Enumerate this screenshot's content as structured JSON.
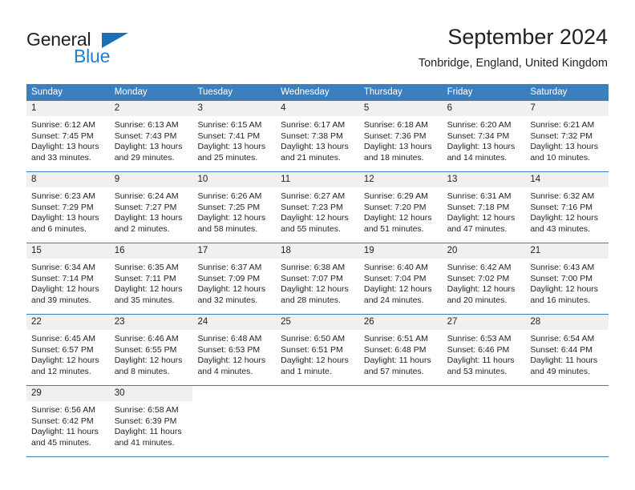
{
  "brand": {
    "name_part1": "General",
    "name_part2": "Blue",
    "accent_color": "#1f7fd4",
    "triangle_color": "#1f6fb5"
  },
  "header": {
    "title": "September 2024",
    "subtitle": "Tonbridge, England, United Kingdom"
  },
  "calendar": {
    "header_color": "#3b7fbf",
    "weekdays": [
      "Sunday",
      "Monday",
      "Tuesday",
      "Wednesday",
      "Thursday",
      "Friday",
      "Saturday"
    ],
    "weeks": [
      [
        {
          "day": "1",
          "sunrise": "Sunrise: 6:12 AM",
          "sunset": "Sunset: 7:45 PM",
          "daylight1": "Daylight: 13 hours",
          "daylight2": "and 33 minutes."
        },
        {
          "day": "2",
          "sunrise": "Sunrise: 6:13 AM",
          "sunset": "Sunset: 7:43 PM",
          "daylight1": "Daylight: 13 hours",
          "daylight2": "and 29 minutes."
        },
        {
          "day": "3",
          "sunrise": "Sunrise: 6:15 AM",
          "sunset": "Sunset: 7:41 PM",
          "daylight1": "Daylight: 13 hours",
          "daylight2": "and 25 minutes."
        },
        {
          "day": "4",
          "sunrise": "Sunrise: 6:17 AM",
          "sunset": "Sunset: 7:38 PM",
          "daylight1": "Daylight: 13 hours",
          "daylight2": "and 21 minutes."
        },
        {
          "day": "5",
          "sunrise": "Sunrise: 6:18 AM",
          "sunset": "Sunset: 7:36 PM",
          "daylight1": "Daylight: 13 hours",
          "daylight2": "and 18 minutes."
        },
        {
          "day": "6",
          "sunrise": "Sunrise: 6:20 AM",
          "sunset": "Sunset: 7:34 PM",
          "daylight1": "Daylight: 13 hours",
          "daylight2": "and 14 minutes."
        },
        {
          "day": "7",
          "sunrise": "Sunrise: 6:21 AM",
          "sunset": "Sunset: 7:32 PM",
          "daylight1": "Daylight: 13 hours",
          "daylight2": "and 10 minutes."
        }
      ],
      [
        {
          "day": "8",
          "sunrise": "Sunrise: 6:23 AM",
          "sunset": "Sunset: 7:29 PM",
          "daylight1": "Daylight: 13 hours",
          "daylight2": "and 6 minutes."
        },
        {
          "day": "9",
          "sunrise": "Sunrise: 6:24 AM",
          "sunset": "Sunset: 7:27 PM",
          "daylight1": "Daylight: 13 hours",
          "daylight2": "and 2 minutes."
        },
        {
          "day": "10",
          "sunrise": "Sunrise: 6:26 AM",
          "sunset": "Sunset: 7:25 PM",
          "daylight1": "Daylight: 12 hours",
          "daylight2": "and 58 minutes."
        },
        {
          "day": "11",
          "sunrise": "Sunrise: 6:27 AM",
          "sunset": "Sunset: 7:23 PM",
          "daylight1": "Daylight: 12 hours",
          "daylight2": "and 55 minutes."
        },
        {
          "day": "12",
          "sunrise": "Sunrise: 6:29 AM",
          "sunset": "Sunset: 7:20 PM",
          "daylight1": "Daylight: 12 hours",
          "daylight2": "and 51 minutes."
        },
        {
          "day": "13",
          "sunrise": "Sunrise: 6:31 AM",
          "sunset": "Sunset: 7:18 PM",
          "daylight1": "Daylight: 12 hours",
          "daylight2": "and 47 minutes."
        },
        {
          "day": "14",
          "sunrise": "Sunrise: 6:32 AM",
          "sunset": "Sunset: 7:16 PM",
          "daylight1": "Daylight: 12 hours",
          "daylight2": "and 43 minutes."
        }
      ],
      [
        {
          "day": "15",
          "sunrise": "Sunrise: 6:34 AM",
          "sunset": "Sunset: 7:14 PM",
          "daylight1": "Daylight: 12 hours",
          "daylight2": "and 39 minutes."
        },
        {
          "day": "16",
          "sunrise": "Sunrise: 6:35 AM",
          "sunset": "Sunset: 7:11 PM",
          "daylight1": "Daylight: 12 hours",
          "daylight2": "and 35 minutes."
        },
        {
          "day": "17",
          "sunrise": "Sunrise: 6:37 AM",
          "sunset": "Sunset: 7:09 PM",
          "daylight1": "Daylight: 12 hours",
          "daylight2": "and 32 minutes."
        },
        {
          "day": "18",
          "sunrise": "Sunrise: 6:38 AM",
          "sunset": "Sunset: 7:07 PM",
          "daylight1": "Daylight: 12 hours",
          "daylight2": "and 28 minutes."
        },
        {
          "day": "19",
          "sunrise": "Sunrise: 6:40 AM",
          "sunset": "Sunset: 7:04 PM",
          "daylight1": "Daylight: 12 hours",
          "daylight2": "and 24 minutes."
        },
        {
          "day": "20",
          "sunrise": "Sunrise: 6:42 AM",
          "sunset": "Sunset: 7:02 PM",
          "daylight1": "Daylight: 12 hours",
          "daylight2": "and 20 minutes."
        },
        {
          "day": "21",
          "sunrise": "Sunrise: 6:43 AM",
          "sunset": "Sunset: 7:00 PM",
          "daylight1": "Daylight: 12 hours",
          "daylight2": "and 16 minutes."
        }
      ],
      [
        {
          "day": "22",
          "sunrise": "Sunrise: 6:45 AM",
          "sunset": "Sunset: 6:57 PM",
          "daylight1": "Daylight: 12 hours",
          "daylight2": "and 12 minutes."
        },
        {
          "day": "23",
          "sunrise": "Sunrise: 6:46 AM",
          "sunset": "Sunset: 6:55 PM",
          "daylight1": "Daylight: 12 hours",
          "daylight2": "and 8 minutes."
        },
        {
          "day": "24",
          "sunrise": "Sunrise: 6:48 AM",
          "sunset": "Sunset: 6:53 PM",
          "daylight1": "Daylight: 12 hours",
          "daylight2": "and 4 minutes."
        },
        {
          "day": "25",
          "sunrise": "Sunrise: 6:50 AM",
          "sunset": "Sunset: 6:51 PM",
          "daylight1": "Daylight: 12 hours",
          "daylight2": "and 1 minute."
        },
        {
          "day": "26",
          "sunrise": "Sunrise: 6:51 AM",
          "sunset": "Sunset: 6:48 PM",
          "daylight1": "Daylight: 11 hours",
          "daylight2": "and 57 minutes."
        },
        {
          "day": "27",
          "sunrise": "Sunrise: 6:53 AM",
          "sunset": "Sunset: 6:46 PM",
          "daylight1": "Daylight: 11 hours",
          "daylight2": "and 53 minutes."
        },
        {
          "day": "28",
          "sunrise": "Sunrise: 6:54 AM",
          "sunset": "Sunset: 6:44 PM",
          "daylight1": "Daylight: 11 hours",
          "daylight2": "and 49 minutes."
        }
      ],
      [
        {
          "day": "29",
          "sunrise": "Sunrise: 6:56 AM",
          "sunset": "Sunset: 6:42 PM",
          "daylight1": "Daylight: 11 hours",
          "daylight2": "and 45 minutes."
        },
        {
          "day": "30",
          "sunrise": "Sunrise: 6:58 AM",
          "sunset": "Sunset: 6:39 PM",
          "daylight1": "Daylight: 11 hours",
          "daylight2": "and 41 minutes."
        },
        {
          "day": "",
          "sunrise": "",
          "sunset": "",
          "daylight1": "",
          "daylight2": ""
        },
        {
          "day": "",
          "sunrise": "",
          "sunset": "",
          "daylight1": "",
          "daylight2": ""
        },
        {
          "day": "",
          "sunrise": "",
          "sunset": "",
          "daylight1": "",
          "daylight2": ""
        },
        {
          "day": "",
          "sunrise": "",
          "sunset": "",
          "daylight1": "",
          "daylight2": ""
        },
        {
          "day": "",
          "sunrise": "",
          "sunset": "",
          "daylight1": "",
          "daylight2": ""
        }
      ]
    ]
  }
}
